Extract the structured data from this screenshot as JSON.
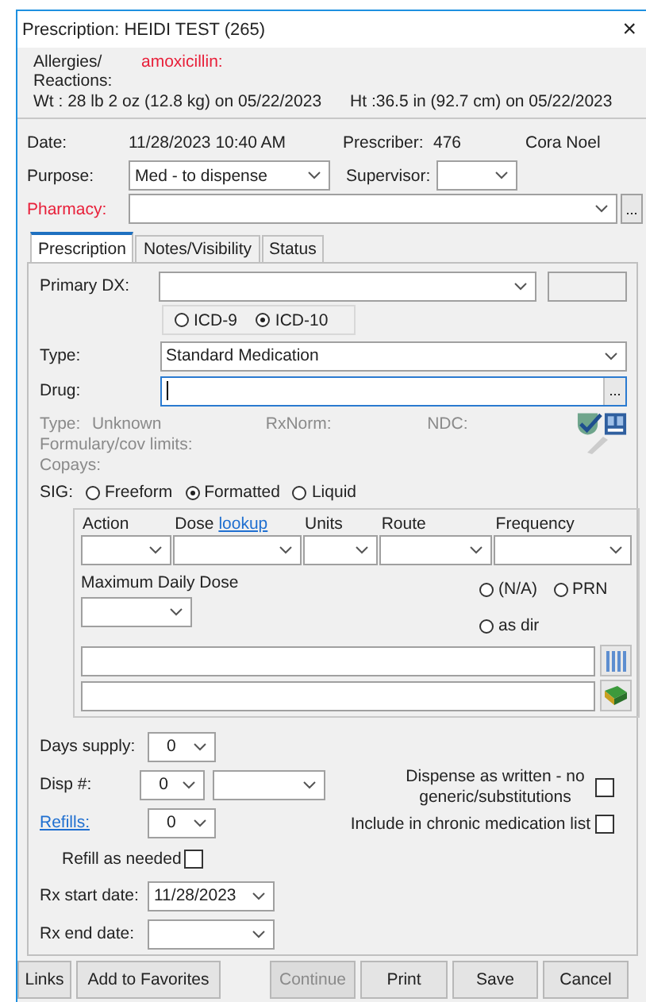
{
  "window": {
    "title": "Prescription: HEIDI TEST (265)",
    "close_glyph": "×"
  },
  "patient": {
    "allergies_label": "Allergies/ Reactions:",
    "allergies": "amoxicillin:",
    "weight": "Wt : 28 lb 2 oz (12.8 kg) on 05/22/2023",
    "height": "Ht :36.5 in (92.7 cm) on 05/22/2023"
  },
  "header": {
    "date_label": "Date:",
    "date": "11/28/2023 10:40 AM",
    "prescriber_label": "Prescriber:",
    "prescriber_id": "476",
    "prescriber_name": "Cora Noel",
    "purpose_label": "Purpose:",
    "purpose": "Med - to dispense",
    "supervisor_label": "Supervisor:",
    "pharmacy_label": "Pharmacy:",
    "pharmacy_required": true,
    "pharmacy_button": "..."
  },
  "tabs": [
    {
      "label": "Prescription",
      "selected": true
    },
    {
      "label": "Notes/Visibility",
      "selected": false
    },
    {
      "label": "Status",
      "selected": false
    }
  ],
  "prescription": {
    "primary_dx_label": "Primary DX:",
    "icd_options": [
      {
        "label": "ICD-9",
        "selected": false
      },
      {
        "label": "ICD-10",
        "selected": true
      }
    ],
    "type_label": "Type:",
    "type": "Standard Medication",
    "drug_label": "Drug:",
    "drug_focused": true,
    "drug_button": "...",
    "info_type_label": "Type:",
    "info_type": "Unknown",
    "rxnorm_label": "RxNorm:",
    "ndc_label": "NDC:",
    "formulary_label": "Formulary/cov limits:",
    "copays_label": "Copays:",
    "sig_label": "SIG:",
    "sig_options": [
      {
        "label": "Freeform",
        "selected": false
      },
      {
        "label": "Formatted",
        "selected": true
      },
      {
        "label": "Liquid",
        "selected": false
      }
    ],
    "sig_columns": [
      {
        "label": "Action"
      },
      {
        "label": "Dose",
        "link": "lookup"
      },
      {
        "label": "Units"
      },
      {
        "label": "Route"
      },
      {
        "label": "Frequency"
      }
    ],
    "max_dose_label": "Maximum Daily Dose",
    "dose_options": [
      {
        "label": "(N/A)",
        "selected": false
      },
      {
        "label": "PRN",
        "selected": false
      },
      {
        "label": "as dir",
        "selected": false
      }
    ],
    "days_supply_label": "Days supply:",
    "days_supply": "0",
    "disp_label": "Disp #:",
    "disp": "0",
    "refills_label": "Refills:",
    "refills": "0",
    "daw_label": "Dispense as written - no generic/substitutions",
    "daw_checked": false,
    "chronic_label": "Include in chronic medication list",
    "chronic_checked": false,
    "refill_needed_label": "Refill as needed",
    "refill_needed_checked": false,
    "start_label": "Rx start date:",
    "start": "11/28/2023",
    "end_label": "Rx end date:"
  },
  "buttons": [
    {
      "label": "Links",
      "disabled": false
    },
    {
      "label": "Add to Favorites",
      "disabled": false
    },
    {
      "label": "Continue",
      "disabled": true
    },
    {
      "label": "Print",
      "disabled": false
    },
    {
      "label": "Save",
      "disabled": false
    },
    {
      "label": "Cancel",
      "disabled": false
    }
  ]
}
